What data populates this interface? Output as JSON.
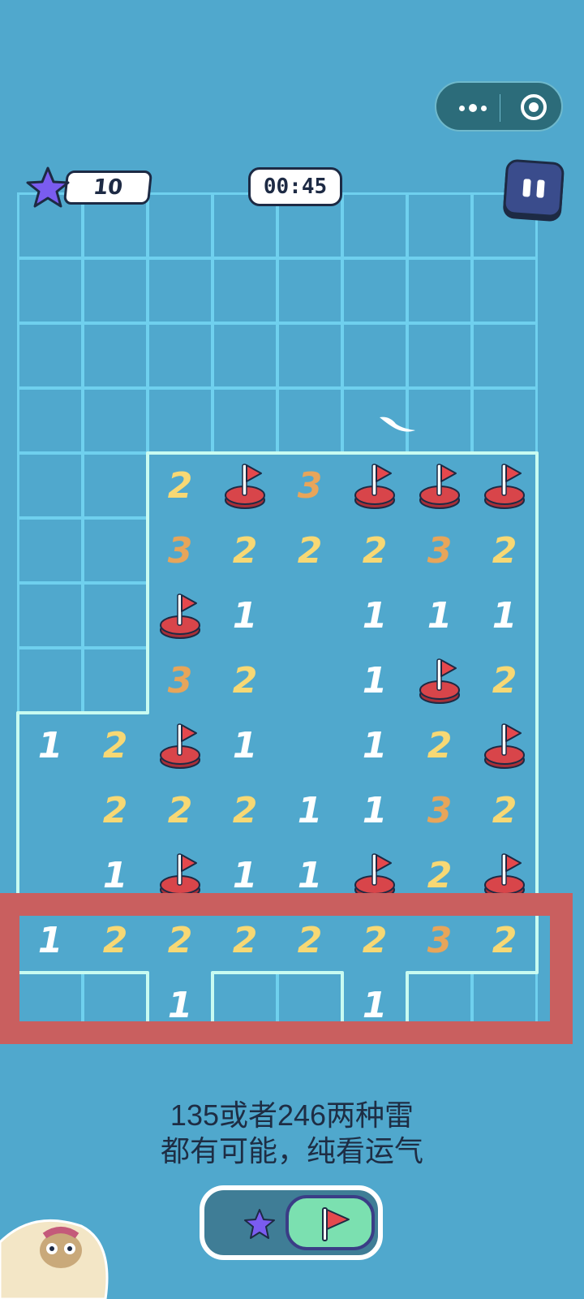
{
  "hud": {
    "star_count": "10",
    "timer": "00:45"
  },
  "capsule": {
    "more_icon": "more-dots-icon",
    "close_icon": "target-close-icon"
  },
  "board": {
    "cols": 8,
    "rows": 13,
    "cells": [
      "........",
      "........",
      "........",
      "........",
      "..2F3FFF",
      "..322232",
      "..F1.111",
      "..32.1F2",
      "12F1.12F",
      ".2221132",
      ".1F11F2F",
      "12222232",
      "..1..1.."
    ],
    "opened_mask": [
      "00000000",
      "00000000",
      "00000000",
      "00000000",
      "00111111",
      "00111111",
      "00111111",
      "00111111",
      "11111111",
      "11111111",
      "11111111",
      "11111111",
      "00100100"
    ]
  },
  "hint_lines": [
    "135或者246两种雷",
    "都有可能，纯看运气"
  ],
  "toggle": {
    "left_icon": "star-icon",
    "active_icon": "flag-icon",
    "mode": "flag"
  },
  "colors": {
    "background": "#50a8cd",
    "grid_line": "#6fd0ee",
    "flag_red": "#d8454a",
    "highlight": "#c95f5f",
    "num1": "#ffffff",
    "num2": "#f7d874",
    "num3": "#e7a55a"
  }
}
